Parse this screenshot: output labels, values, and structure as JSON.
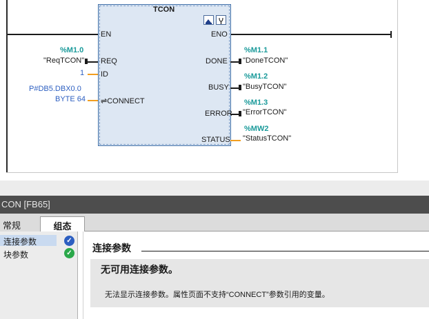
{
  "block": {
    "name": "TCON",
    "pins_in": {
      "en": "EN",
      "req": "REQ",
      "id": "ID",
      "connect": "⇌CONNECT"
    },
    "pins_out": {
      "eno": "ENO",
      "done": "DONE",
      "busy": "BUSY",
      "error": "ERROR",
      "status": "STATUS"
    }
  },
  "operands": {
    "req_addr": "%M1.0",
    "req_tag": "\"ReqTCON\"",
    "id_value": "1",
    "connect_line1": "P#DB5.DBX0.0",
    "connect_line2": "BYTE 64",
    "done_addr": "%M1.1",
    "done_tag": "\"DoneTCON\"",
    "busy_addr": "%M1.2",
    "busy_tag": "\"BusyTCON\"",
    "error_addr": "%M1.3",
    "error_tag": "\"ErrorTCON\"",
    "status_addr": "%MW2",
    "status_tag": "\"StatusTCON\""
  },
  "inspector": {
    "title": "CON [FB65]",
    "tabs": [
      "常规",
      "组态"
    ],
    "active_tab": "组态",
    "nav": [
      {
        "label": "连接参数",
        "status": "info",
        "selected": true
      },
      {
        "label": "块参数",
        "status": "ok",
        "selected": false
      }
    ],
    "section_title": "连接参数",
    "message_title": "无可用连接参数。",
    "message_body": "无法显示连接参数。属性页面不支持“CONNECT”参数引用的变量。"
  },
  "colors": {
    "operand_address": "#1a9a9a",
    "constant": "#2d5fc1",
    "block_fill": "#dde7f3",
    "title_bar": "#4d4d4d",
    "status_info": "#2d5fc1",
    "status_ok": "#2aa84a"
  },
  "icons": [
    "fb-open-icon",
    "fb-settings-icon",
    "status-info-icon",
    "status-ok-icon"
  ]
}
